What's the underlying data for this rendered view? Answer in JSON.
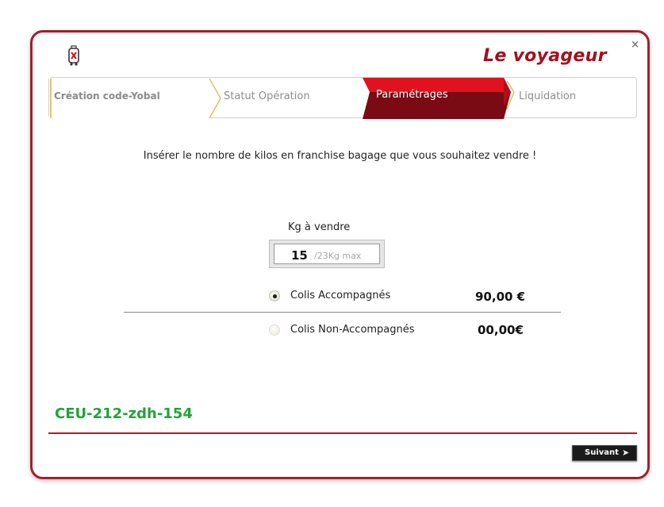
{
  "window": {
    "title": "Le voyageur",
    "close_label": "×"
  },
  "stepper": {
    "steps": [
      {
        "label": "Création code-Yobal",
        "state": "done"
      },
      {
        "label": "Statut Opération",
        "state": "pending"
      },
      {
        "label": "Paramétrages",
        "state": "active"
      },
      {
        "label": "Liquidation",
        "state": "pending"
      }
    ]
  },
  "form": {
    "instruction": "Insérer le nombre de kilos en franchise bagage que vous souhaitez vendre !",
    "kg_label": "Kg à vendre",
    "kg_value": "15",
    "kg_max": "/23Kg max",
    "options": [
      {
        "label": "Colis Accompagnés",
        "price": "90,00 €",
        "selected": true
      },
      {
        "label": "Colis Non-Accompagnés",
        "price": "00,00€",
        "selected": false
      }
    ]
  },
  "footer": {
    "code": "CEU-212-zdh-154",
    "next_label": "Suivant",
    "next_arrow": "➤"
  },
  "colors": {
    "brand": "#a3101c",
    "border": "#a31e2c",
    "active_step": "#c8101c",
    "code_green": "#23a23a"
  },
  "icons": [
    "luggage-icon",
    "close-icon",
    "radio-icon",
    "arrow-right-icon"
  ]
}
